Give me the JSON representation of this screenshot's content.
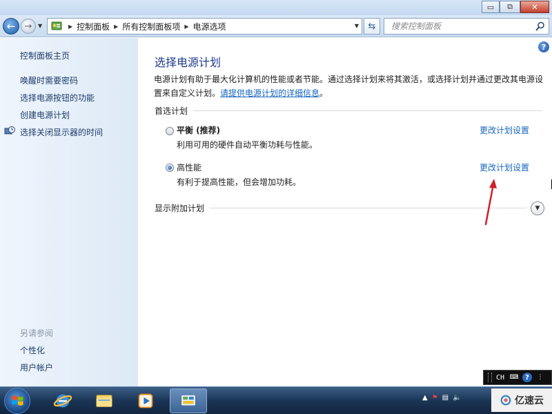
{
  "window": {
    "minimize": "▭",
    "maximize": "⧉",
    "close": "✕"
  },
  "address": {
    "breadcrumbs": [
      "控制面板",
      "所有控制面板项",
      "电源选项"
    ],
    "search_placeholder": "搜索控制面板"
  },
  "sidebar": {
    "home": "控制面板主页",
    "links": [
      "唤醒时需要密码",
      "选择电源按钮的功能",
      "创建电源计划",
      "选择关闭显示器的时间"
    ],
    "see_also": "另请参阅",
    "see_also_links": [
      "个性化",
      "用户帐户"
    ]
  },
  "main": {
    "title": "选择电源计划",
    "intro_text": "电源计划有助于最大化计算机的性能或者节能。通过选择计划来将其激活，或选择计划并通过更改其电源设置来自定义计划。",
    "intro_link": "请提供电源计划的详细信息",
    "intro_end": "。",
    "preferred_plans": "首选计划",
    "plans": [
      {
        "name": "平衡 (推荐)",
        "description": "利用可用的硬件自动平衡功耗与性能。",
        "link": "更改计划设置",
        "selected": false
      },
      {
        "name": "高性能",
        "description": "有利于提高性能，但会增加功耗。",
        "link": "更改计划设置",
        "selected": true
      }
    ],
    "show_additional": "显示附加计划"
  },
  "langbar": {
    "lang": "CH"
  },
  "watermark": "亿速云",
  "colors": {
    "link": "#1566c0",
    "title": "#1e3b8a",
    "arrow": "#d0202a"
  }
}
